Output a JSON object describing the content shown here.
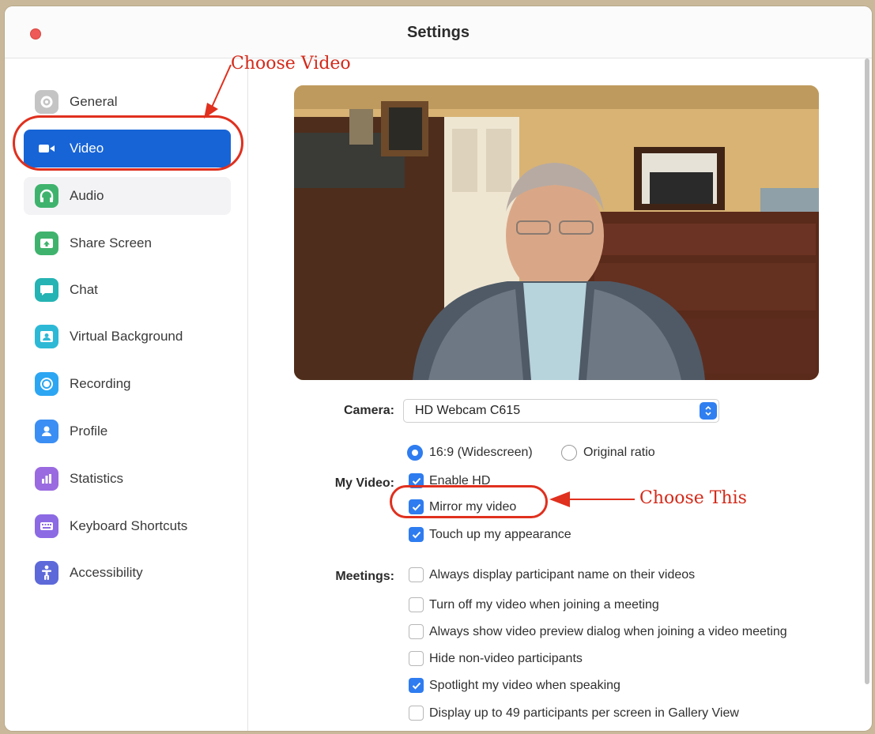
{
  "window": {
    "title": "Settings"
  },
  "sidebar": {
    "items": [
      {
        "label": "General",
        "icon": "gear-icon",
        "color": "#b9b9b9",
        "state": "normal"
      },
      {
        "label": "Video",
        "icon": "video-camera-icon",
        "color": "#ffffff",
        "state": "active"
      },
      {
        "label": "Audio",
        "icon": "headphones-icon",
        "color": "#3fb36d",
        "state": "hover"
      },
      {
        "label": "Share Screen",
        "icon": "share-screen-icon",
        "color": "#3fb36d",
        "state": "normal"
      },
      {
        "label": "Chat",
        "icon": "chat-bubble-icon",
        "color": "#25b3b3",
        "state": "normal"
      },
      {
        "label": "Virtual Background",
        "icon": "portrait-icon",
        "color": "#2db9d6",
        "state": "normal"
      },
      {
        "label": "Recording",
        "icon": "record-icon",
        "color": "#2ca6f2",
        "state": "normal"
      },
      {
        "label": "Profile",
        "icon": "user-icon",
        "color": "#3b8ef3",
        "state": "normal"
      },
      {
        "label": "Statistics",
        "icon": "bar-chart-icon",
        "color": "#9a6ae0",
        "state": "normal"
      },
      {
        "label": "Keyboard Shortcuts",
        "icon": "keyboard-icon",
        "color": "#8c6ae4",
        "state": "normal"
      },
      {
        "label": "Accessibility",
        "icon": "accessibility-icon",
        "color": "#5d69d9",
        "state": "normal"
      }
    ]
  },
  "video": {
    "camera_label": "Camera:",
    "camera_value": "HD Webcam C615",
    "ratio_options": [
      {
        "label": "16:9 (Widescreen)",
        "selected": true
      },
      {
        "label": "Original ratio",
        "selected": false
      }
    ],
    "my_video_label": "My Video:",
    "my_video_options": [
      {
        "label": "Enable HD",
        "checked": true
      },
      {
        "label": "Mirror my video",
        "checked": true
      },
      {
        "label": "Touch up my appearance",
        "checked": true
      }
    ],
    "meetings_label": "Meetings:",
    "meetings_options": [
      {
        "label": "Always display participant name on their videos",
        "checked": false
      },
      {
        "label": "Turn off my video when joining a meeting",
        "checked": false
      },
      {
        "label": "Always show video preview dialog when joining a video meeting",
        "checked": false
      },
      {
        "label": "Hide non-video participants",
        "checked": false
      },
      {
        "label": "Spotlight my video when speaking",
        "checked": true
      },
      {
        "label": "Display up to 49 participants per screen in Gallery View",
        "checked": false
      }
    ]
  },
  "annotations": {
    "choose_video": "Choose Video",
    "choose_this": "Choose This",
    "color": "#e0301e"
  },
  "colors": {
    "accent": "#1764d6",
    "checkbox": "#2e7cf0"
  }
}
